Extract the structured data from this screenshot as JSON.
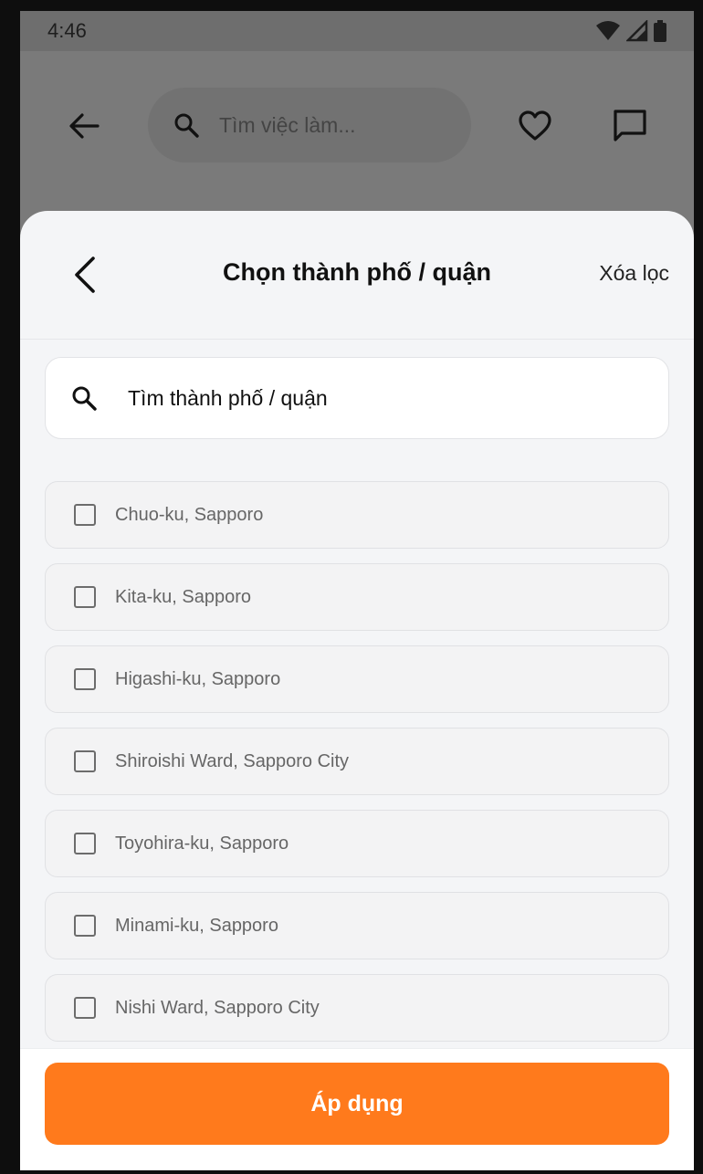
{
  "status_bar": {
    "time": "4:46"
  },
  "top_bar": {
    "search_placeholder": "Tìm việc làm..."
  },
  "sheet": {
    "title": "Chọn thành phố / quận",
    "clear_label": "Xóa lọc",
    "search_placeholder": "Tìm thành phố / quận",
    "items": [
      {
        "label": "Chuo-ku, Sapporo",
        "checked": false
      },
      {
        "label": "Kita-ku, Sapporo",
        "checked": false
      },
      {
        "label": "Higashi-ku, Sapporo",
        "checked": false
      },
      {
        "label": "Shiroishi Ward, Sapporo City",
        "checked": false
      },
      {
        "label": "Toyohira-ku, Sapporo",
        "checked": false
      },
      {
        "label": "Minami-ku, Sapporo",
        "checked": false
      },
      {
        "label": "Nishi Ward, Sapporo City",
        "checked": false
      }
    ],
    "apply_label": "Áp dụng"
  },
  "colors": {
    "accent": "#ff7a1c"
  },
  "icons": [
    "wifi-icon",
    "signal-icon",
    "battery-icon",
    "back-arrow-icon",
    "search-icon",
    "heart-icon",
    "chat-icon",
    "chevron-left-icon",
    "checkbox-icon"
  ]
}
